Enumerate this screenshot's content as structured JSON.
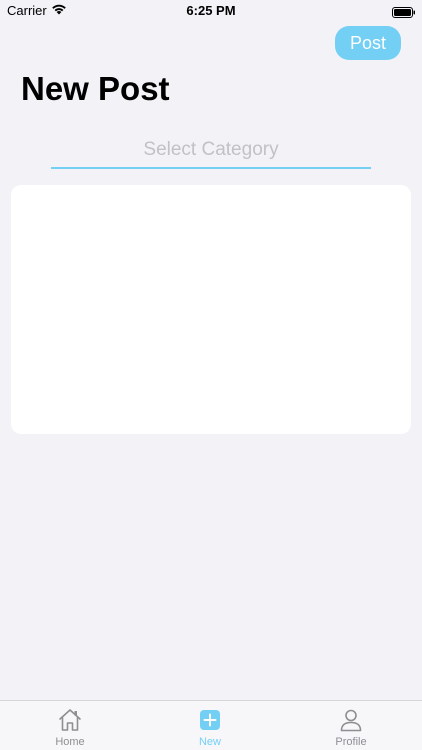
{
  "status_bar": {
    "carrier": "Carrier",
    "time": "6:25 PM"
  },
  "header": {
    "post_label": "Post",
    "title": "New Post"
  },
  "category": {
    "placeholder": "Select Category"
  },
  "tab_bar": {
    "items": [
      {
        "label": "Home",
        "icon": "home-icon",
        "active": false
      },
      {
        "label": "New",
        "icon": "plus-square-icon",
        "active": true
      },
      {
        "label": "Profile",
        "icon": "person-icon",
        "active": false
      }
    ]
  },
  "colors": {
    "accent": "#74cff5",
    "background": "#f2f2f7",
    "card": "#ffffff",
    "inactive": "#8e8e93",
    "placeholder": "#c1c1c6"
  }
}
